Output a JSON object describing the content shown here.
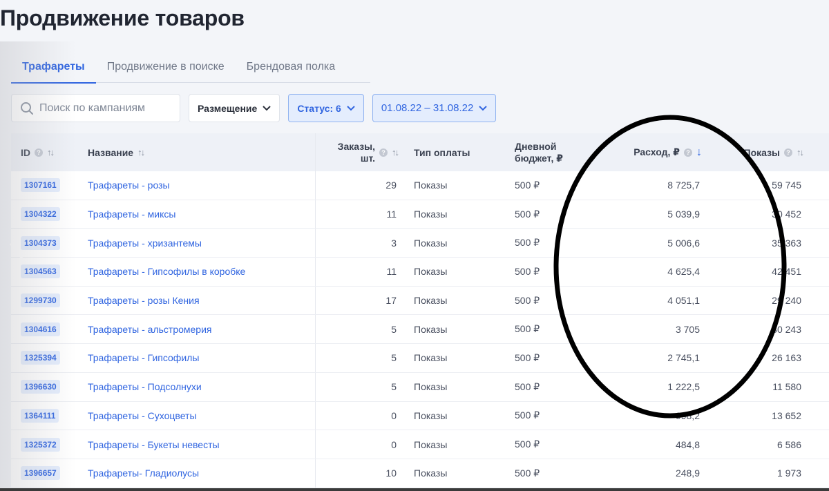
{
  "page_title": "Продвижение товаров",
  "tabs": [
    {
      "label": "Трафареты",
      "active": true
    },
    {
      "label": "Продвижение в поиске",
      "active": false
    },
    {
      "label": "Брендовая полка",
      "active": false
    }
  ],
  "filters": {
    "search_placeholder": "Поиск по кампаниям",
    "placement_label": "Размещение",
    "status_label": "Статус: 6",
    "date_range": "01.08.22 – 31.08.22"
  },
  "columns": {
    "id": "ID",
    "name": "Название",
    "orders_line1": "Заказы,",
    "orders_line2": "шт.",
    "payment_type": "Тип оплаты",
    "budget_line1": "Дневной",
    "budget_line2": "бюджет, ₽",
    "spend": "Расход, ₽",
    "impressions": "Показы"
  },
  "rows": [
    {
      "id": "1307161",
      "name": "Трафареты - розы",
      "orders": "29",
      "payment": "Показы",
      "budget": "500 ₽",
      "spend": "8 725,7",
      "impressions": "59 745"
    },
    {
      "id": "1304322",
      "name": "Трафареты - миксы",
      "orders": "11",
      "payment": "Показы",
      "budget": "500 ₽",
      "spend": "5 039,9",
      "impressions": "30 452"
    },
    {
      "id": "1304373",
      "name": "Трафареты - хризантемы",
      "orders": "3",
      "payment": "Показы",
      "budget": "500 ₽",
      "spend": "5 006,6",
      "impressions": "35 363"
    },
    {
      "id": "1304563",
      "name": "Трафареты - Гипсофилы в коробке",
      "orders": "11",
      "payment": "Показы",
      "budget": "500 ₽",
      "spend": "4 625,4",
      "impressions": "42 451"
    },
    {
      "id": "1299730",
      "name": "Трафареты - розы Кения",
      "orders": "17",
      "payment": "Показы",
      "budget": "500 ₽",
      "spend": "4 051,1",
      "impressions": "29 240"
    },
    {
      "id": "1304616",
      "name": "Трафареты - альстромерия",
      "orders": "5",
      "payment": "Показы",
      "budget": "500 ₽",
      "spend": "3 705",
      "impressions": "30 243"
    },
    {
      "id": "1325394",
      "name": "Трафареты - Гипсофилы",
      "orders": "5",
      "payment": "Показы",
      "budget": "500 ₽",
      "spend": "2 745,1",
      "impressions": "26 163"
    },
    {
      "id": "1396630",
      "name": "Трафареты - Подсолнухи",
      "orders": "5",
      "payment": "Показы",
      "budget": "500 ₽",
      "spend": "1 222,5",
      "impressions": "11 580"
    },
    {
      "id": "1364111",
      "name": "Трафареты - Сухоцветы",
      "orders": "0",
      "payment": "Показы",
      "budget": "500 ₽",
      "spend": "998,2",
      "impressions": "13 652"
    },
    {
      "id": "1325372",
      "name": "Трафареты - Букеты невесты",
      "orders": "0",
      "payment": "Показы",
      "budget": "500 ₽",
      "spend": "484,8",
      "impressions": "6 586"
    },
    {
      "id": "1396657",
      "name": "Трафареты- Гладиолусы",
      "orders": "10",
      "payment": "Показы",
      "budget": "500 ₽",
      "spend": "248,9",
      "impressions": "1 973"
    }
  ],
  "colors": {
    "accent": "#2f64e0",
    "badge_bg": "#e4edfd",
    "header_bg": "#eef1f7"
  }
}
